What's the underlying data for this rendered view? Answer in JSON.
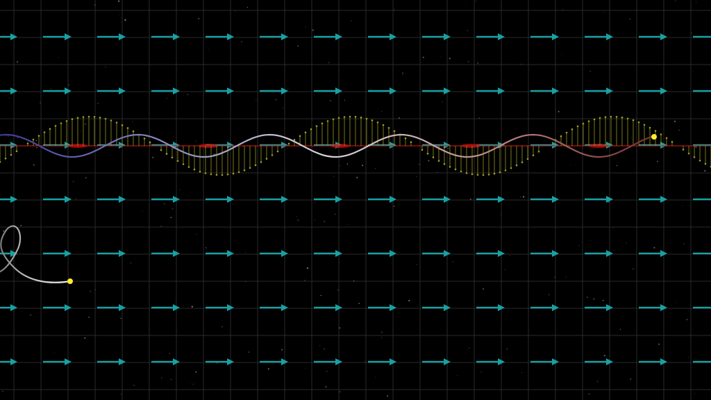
{
  "scene": {
    "background_color": "#000000",
    "grid_color": "#2a2a2a",
    "field_arrow_color": "#1aa0a3",
    "axis_line_color": "#cc1111",
    "trail_gradient": [
      "#3a3a9a",
      "#8a8ac0",
      "#d8d8e0",
      "#c08a8a",
      "#7a3030"
    ],
    "e_vector_color": "#a0a020",
    "particle_color": "#ffee33",
    "spiral_color": "#d8d8d8"
  }
}
